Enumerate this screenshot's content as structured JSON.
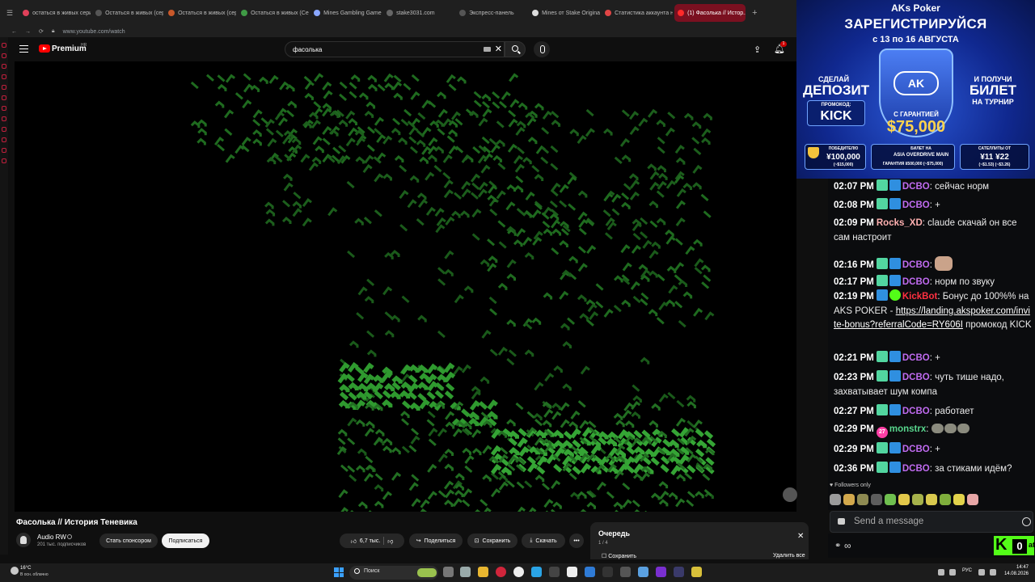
{
  "browser": {
    "tabs": [
      {
        "label": "остаться в живых серия",
        "favicon": "#e0405a"
      },
      {
        "label": "Остаться в живых (сер...",
        "favicon": "#555555"
      },
      {
        "label": "Остаться в живых (сер...",
        "favicon": "#c8582a"
      },
      {
        "label": "Остаться в живых (Сер...",
        "favicon": "#3f9a45"
      },
      {
        "label": "Mines Gambling Game In...",
        "favicon": "#8aa7ff"
      },
      {
        "label": "stake3031.com",
        "favicon": "#666666"
      },
      {
        "label": "Экспресс-панель",
        "favicon": "#555555"
      },
      {
        "label": "Mines от Stake Originals",
        "favicon": "#dddddd"
      },
      {
        "label": "Статистика аккаунта н...",
        "favicon": "#e04545"
      },
      {
        "label": "(1) Фасолька // Истор...",
        "favicon": "#ff2a2a",
        "active": true
      }
    ],
    "url": "www.youtube.com/watch"
  },
  "youtube": {
    "brand": "Premium",
    "brand_badge": "HR",
    "search_value": "фасолька",
    "notification_count": "1",
    "video_title": "Фасолька // История Теневика",
    "channel_name": "Audio RW",
    "subscribers": "201 тыс. подписчиков",
    "sponsor_label": "Стать спонсором",
    "subscribe_label": "Подписаться",
    "likes": "6,7 тыс.",
    "share_label": "Поделиться",
    "save_label": "Сохранить",
    "download_label": "Скачать",
    "more_label": "•••",
    "queue": {
      "title": "Очередь",
      "count": "1 / 4",
      "save": "Сохранить",
      "clear": "Удалить все"
    }
  },
  "ad": {
    "brand": "AKs Poker",
    "headline": "ЗАРЕГИСТРИРУЙСЯ",
    "dates": "с 13 по 16 АВГУСТА",
    "shield_logo": "AK",
    "left_line1": "СДЕЛАЙ",
    "left_line2": "ДЕПОЗИТ",
    "promo_label": "ПРОМОКОД:",
    "promo_code": "KICK",
    "right_line1": "И ПОЛУЧИ",
    "right_line2": "БИЛЕТ",
    "right_line3": "НА ТУРНИР",
    "guarantee_label": "С ГАРАНТИЕЙ",
    "guarantee_value": "$75,000",
    "card1_label": "ПОБЕДИТЕЛЮ",
    "card1_value": "¥100,000",
    "card1_sub": "(~$15,000)",
    "card2_label": "БИЛЕТ НА",
    "card2_value": "ASIA OVERDRIVE MAIN",
    "card2_sub": "ГАРАНТИЯ ¥500,000 (~$75,000)",
    "card3_label": "САТЕЛЛИТЫ ОТ",
    "card3_value": "¥11  ¥22",
    "card3_sub": "(~$1.53)  (~$3.26)"
  },
  "chat": {
    "messages": [
      {
        "time": "02:07 PM",
        "badges": [
          "green",
          "blue"
        ],
        "user": "DCBO",
        "user_color": "#c06bf0",
        "text": "сейчас норм"
      },
      {
        "time": "02:08 PM",
        "badges": [
          "green",
          "blue"
        ],
        "user": "DCBO",
        "user_color": "#c06bf0",
        "text": "+"
      },
      {
        "time": "02:09 PM",
        "badges": [],
        "user": "Rocks_XD",
        "user_color": "#ffb0b0",
        "text": "claude скачай он все сам настроит"
      },
      {
        "time": "02:16 PM",
        "badges": [
          "green",
          "blue"
        ],
        "user": "DCBO",
        "user_color": "#c06bf0",
        "text": ""
      },
      {
        "time": "02:17 PM",
        "badges": [
          "green",
          "blue"
        ],
        "user": "DCBO",
        "user_color": "#c06bf0",
        "text": "норм по звуку"
      },
      {
        "time": "02:19 PM",
        "badges": [
          "blue",
          "verified"
        ],
        "user": "KickBot",
        "user_color": "#ff3040",
        "text": "Бонус до 100%% на AKS POKER -",
        "link": "https://landing.akspoker.com/invite-bonus?referralCode=RY606I",
        "after": "промокод KICK"
      },
      {
        "time": "02:21 PM",
        "badges": [
          "green",
          "blue"
        ],
        "user": "DCBO",
        "user_color": "#c06bf0",
        "text": "+"
      },
      {
        "time": "02:23 PM",
        "badges": [
          "green",
          "blue"
        ],
        "user": "DCBO",
        "user_color": "#c06bf0",
        "text": "чуть тише надо, захватывает шум компа"
      },
      {
        "time": "02:27 PM",
        "badges": [
          "green",
          "blue"
        ],
        "user": "DCBO",
        "user_color": "#c06bf0",
        "text": "работает"
      },
      {
        "time": "02:29 PM",
        "badges": [
          "pink"
        ],
        "pink_label": "27",
        "user": "monstrx",
        "user_color": "#58d68d",
        "text": ""
      },
      {
        "time": "02:29 PM",
        "badges": [
          "green",
          "blue"
        ],
        "user": "DCBO",
        "user_color": "#c06bf0",
        "text": "+"
      },
      {
        "time": "02:36 PM",
        "badges": [
          "green",
          "blue"
        ],
        "user": "DCBO",
        "user_color": "#c06bf0",
        "text": "за стиками идём?"
      }
    ],
    "followers_only": "Followers only",
    "send_placeholder": "Send a message",
    "points": "∞",
    "viewer_count": "0",
    "kick_letter": "K",
    "kick_suffix": "at"
  },
  "taskbar": {
    "weather_temp": "16°C",
    "weather_desc": "В осн. облачно",
    "search_label": "Поиск",
    "lang": "РУС",
    "time": "14:47",
    "date": "14.08.2026"
  }
}
